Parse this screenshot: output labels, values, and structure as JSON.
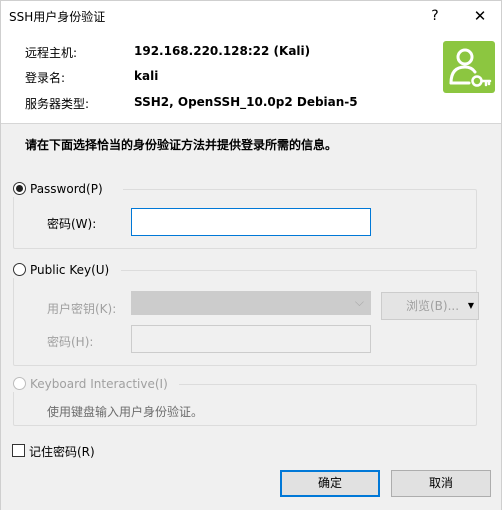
{
  "window": {
    "title": "SSH用户身份验证",
    "help_glyph": "?",
    "close_glyph": "✕"
  },
  "info": {
    "host_label": "远程主机:",
    "host_value": "192.168.220.128:22 (Kali)",
    "user_label": "登录名:",
    "user_value": "kali",
    "type_label": "服务器类型:",
    "type_value": "SSH2, OpenSSH_10.0p2 Debian-5"
  },
  "logo": {
    "icon": "user-key-icon",
    "color": "#8cc640"
  },
  "instruction": "请在下面选择恰当的身份验证方法并提供登录所需的信息。",
  "password_group": {
    "radio_label": "Password(P)",
    "selected": true,
    "field_label": "密码(W):",
    "value": ""
  },
  "publickey_group": {
    "radio_label": "Public Key(U)",
    "selected": false,
    "key_label": "用户密钥(K):",
    "key_value": "",
    "browse_label": "浏览(B)...",
    "passphrase_label": "密码(H):",
    "passphrase_value": ""
  },
  "keyboard_group": {
    "radio_label": "Keyboard Interactive(I)",
    "enabled": false,
    "description": "使用键盘输入用户身份验证。"
  },
  "remember": {
    "label": "记住密码(R)",
    "checked": false
  },
  "buttons": {
    "ok": "确定",
    "cancel": "取消"
  },
  "colors": {
    "accent": "#0078d7",
    "logo_green": "#8cc640"
  }
}
